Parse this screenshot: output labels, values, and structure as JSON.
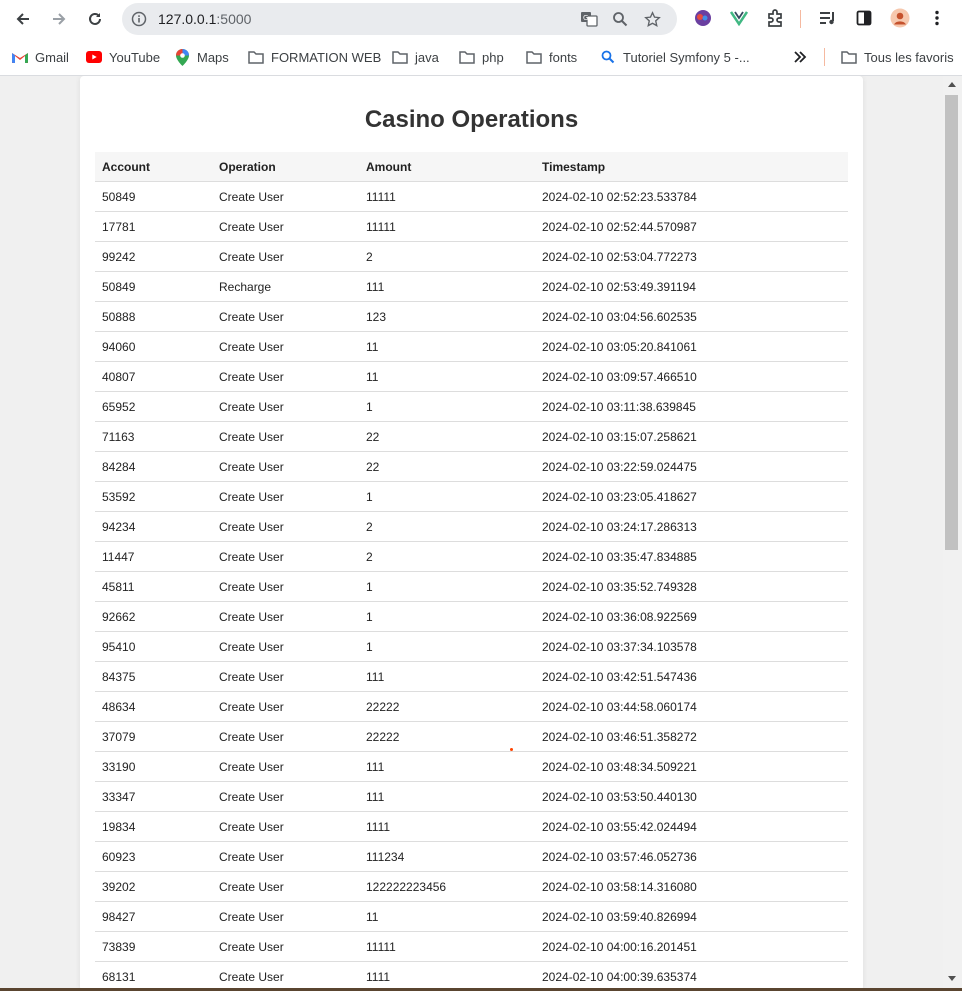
{
  "browser": {
    "url_host": "127.0.0.1",
    "url_port": ":5000"
  },
  "bookmarks": [
    {
      "label": "Gmail",
      "icon": "gmail-icon"
    },
    {
      "label": "YouTube",
      "icon": "youtube-icon"
    },
    {
      "label": "Maps",
      "icon": "maps-icon"
    },
    {
      "label": "FORMATION WEB",
      "icon": "folder-icon"
    },
    {
      "label": "java",
      "icon": "folder-icon"
    },
    {
      "label": "php",
      "icon": "folder-icon"
    },
    {
      "label": "fonts",
      "icon": "folder-icon"
    },
    {
      "label": "Tutoriel Symfony 5 -...",
      "icon": "search-icon"
    },
    {
      "label": "Tous les favoris",
      "icon": "folder-icon"
    }
  ],
  "page": {
    "title": "Casino Operations"
  },
  "table": {
    "headers": [
      "Account",
      "Operation",
      "Amount",
      "Timestamp"
    ],
    "rows": [
      [
        "50849",
        "Create User",
        "11111",
        "2024-02-10 02:52:23.533784"
      ],
      [
        "17781",
        "Create User",
        "11111",
        "2024-02-10 02:52:44.570987"
      ],
      [
        "99242",
        "Create User",
        "2",
        "2024-02-10 02:53:04.772273"
      ],
      [
        "50849",
        "Recharge",
        "111",
        "2024-02-10 02:53:49.391194"
      ],
      [
        "50888",
        "Create User",
        "123",
        "2024-02-10 03:04:56.602535"
      ],
      [
        "94060",
        "Create User",
        "11",
        "2024-02-10 03:05:20.841061"
      ],
      [
        "40807",
        "Create User",
        "11",
        "2024-02-10 03:09:57.466510"
      ],
      [
        "65952",
        "Create User",
        "1",
        "2024-02-10 03:11:38.639845"
      ],
      [
        "71163",
        "Create User",
        "22",
        "2024-02-10 03:15:07.258621"
      ],
      [
        "84284",
        "Create User",
        "22",
        "2024-02-10 03:22:59.024475"
      ],
      [
        "53592",
        "Create User",
        "1",
        "2024-02-10 03:23:05.418627"
      ],
      [
        "94234",
        "Create User",
        "2",
        "2024-02-10 03:24:17.286313"
      ],
      [
        "11447",
        "Create User",
        "2",
        "2024-02-10 03:35:47.834885"
      ],
      [
        "45811",
        "Create User",
        "1",
        "2024-02-10 03:35:52.749328"
      ],
      [
        "92662",
        "Create User",
        "1",
        "2024-02-10 03:36:08.922569"
      ],
      [
        "95410",
        "Create User",
        "1",
        "2024-02-10 03:37:34.103578"
      ],
      [
        "84375",
        "Create User",
        "111",
        "2024-02-10 03:42:51.547436"
      ],
      [
        "48634",
        "Create User",
        "22222",
        "2024-02-10 03:44:58.060174"
      ],
      [
        "37079",
        "Create User",
        "22222",
        "2024-02-10 03:46:51.358272"
      ],
      [
        "33190",
        "Create User",
        "111",
        "2024-02-10 03:48:34.509221"
      ],
      [
        "33347",
        "Create User",
        "111",
        "2024-02-10 03:53:50.440130"
      ],
      [
        "19834",
        "Create User",
        "1111",
        "2024-02-10 03:55:42.024494"
      ],
      [
        "60923",
        "Create User",
        "111234",
        "2024-02-10 03:57:46.052736"
      ],
      [
        "39202",
        "Create User",
        "122222223456",
        "2024-02-10 03:58:14.316080"
      ],
      [
        "98427",
        "Create User",
        "11",
        "2024-02-10 03:59:40.826994"
      ],
      [
        "73839",
        "Create User",
        "11111",
        "2024-02-10 04:00:16.201451"
      ],
      [
        "68131",
        "Create User",
        "1111",
        "2024-02-10 04:00:39.635374"
      ]
    ]
  }
}
